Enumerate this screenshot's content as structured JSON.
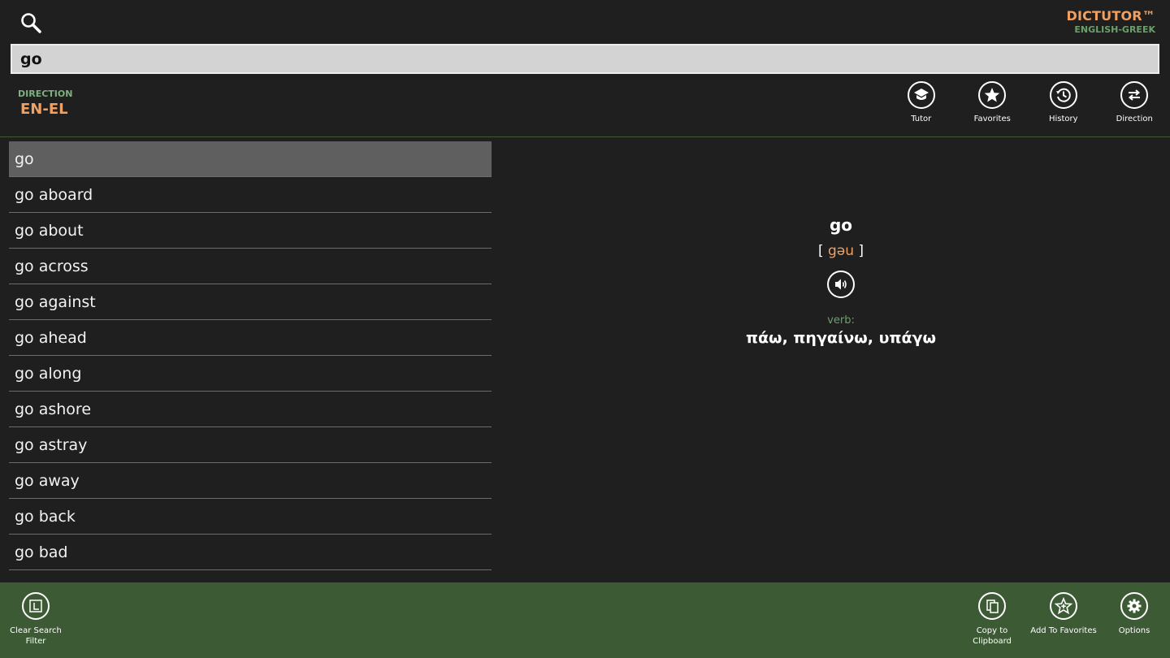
{
  "header": {
    "app_name": "DICTUTOR™",
    "app_subtitle": "ENGLISH-GREEK"
  },
  "search": {
    "value": "go",
    "icon": "search-icon"
  },
  "direction": {
    "label": "DIRECTION",
    "value": "EN-EL"
  },
  "toolbar": {
    "tutor": "Tutor",
    "favorites": "Favorites",
    "history": "History",
    "direction": "Direction"
  },
  "word_list": [
    "go",
    "go aboard",
    "go about",
    "go across",
    "go against",
    "go ahead",
    "go along",
    "go ashore",
    "go astray",
    "go away",
    "go back",
    "go bad"
  ],
  "selected_index": 0,
  "entry": {
    "word": "go",
    "bracket_open": "[",
    "phonetic": "gəu",
    "bracket_close": "]",
    "part_of_speech": "verb:",
    "translation": "πάω, πηγαίνω, υπάγω"
  },
  "bottom_bar": {
    "clear_filter": "Clear Search\nFilter",
    "copy": "Copy to\nClipboard",
    "add_favorites": "Add To Favorites",
    "options": "Options"
  },
  "colors": {
    "accent_orange": "#f0a060",
    "accent_green": "#6aa06a",
    "appbar_green": "#3c5a34",
    "background": "#1f1f1f"
  }
}
